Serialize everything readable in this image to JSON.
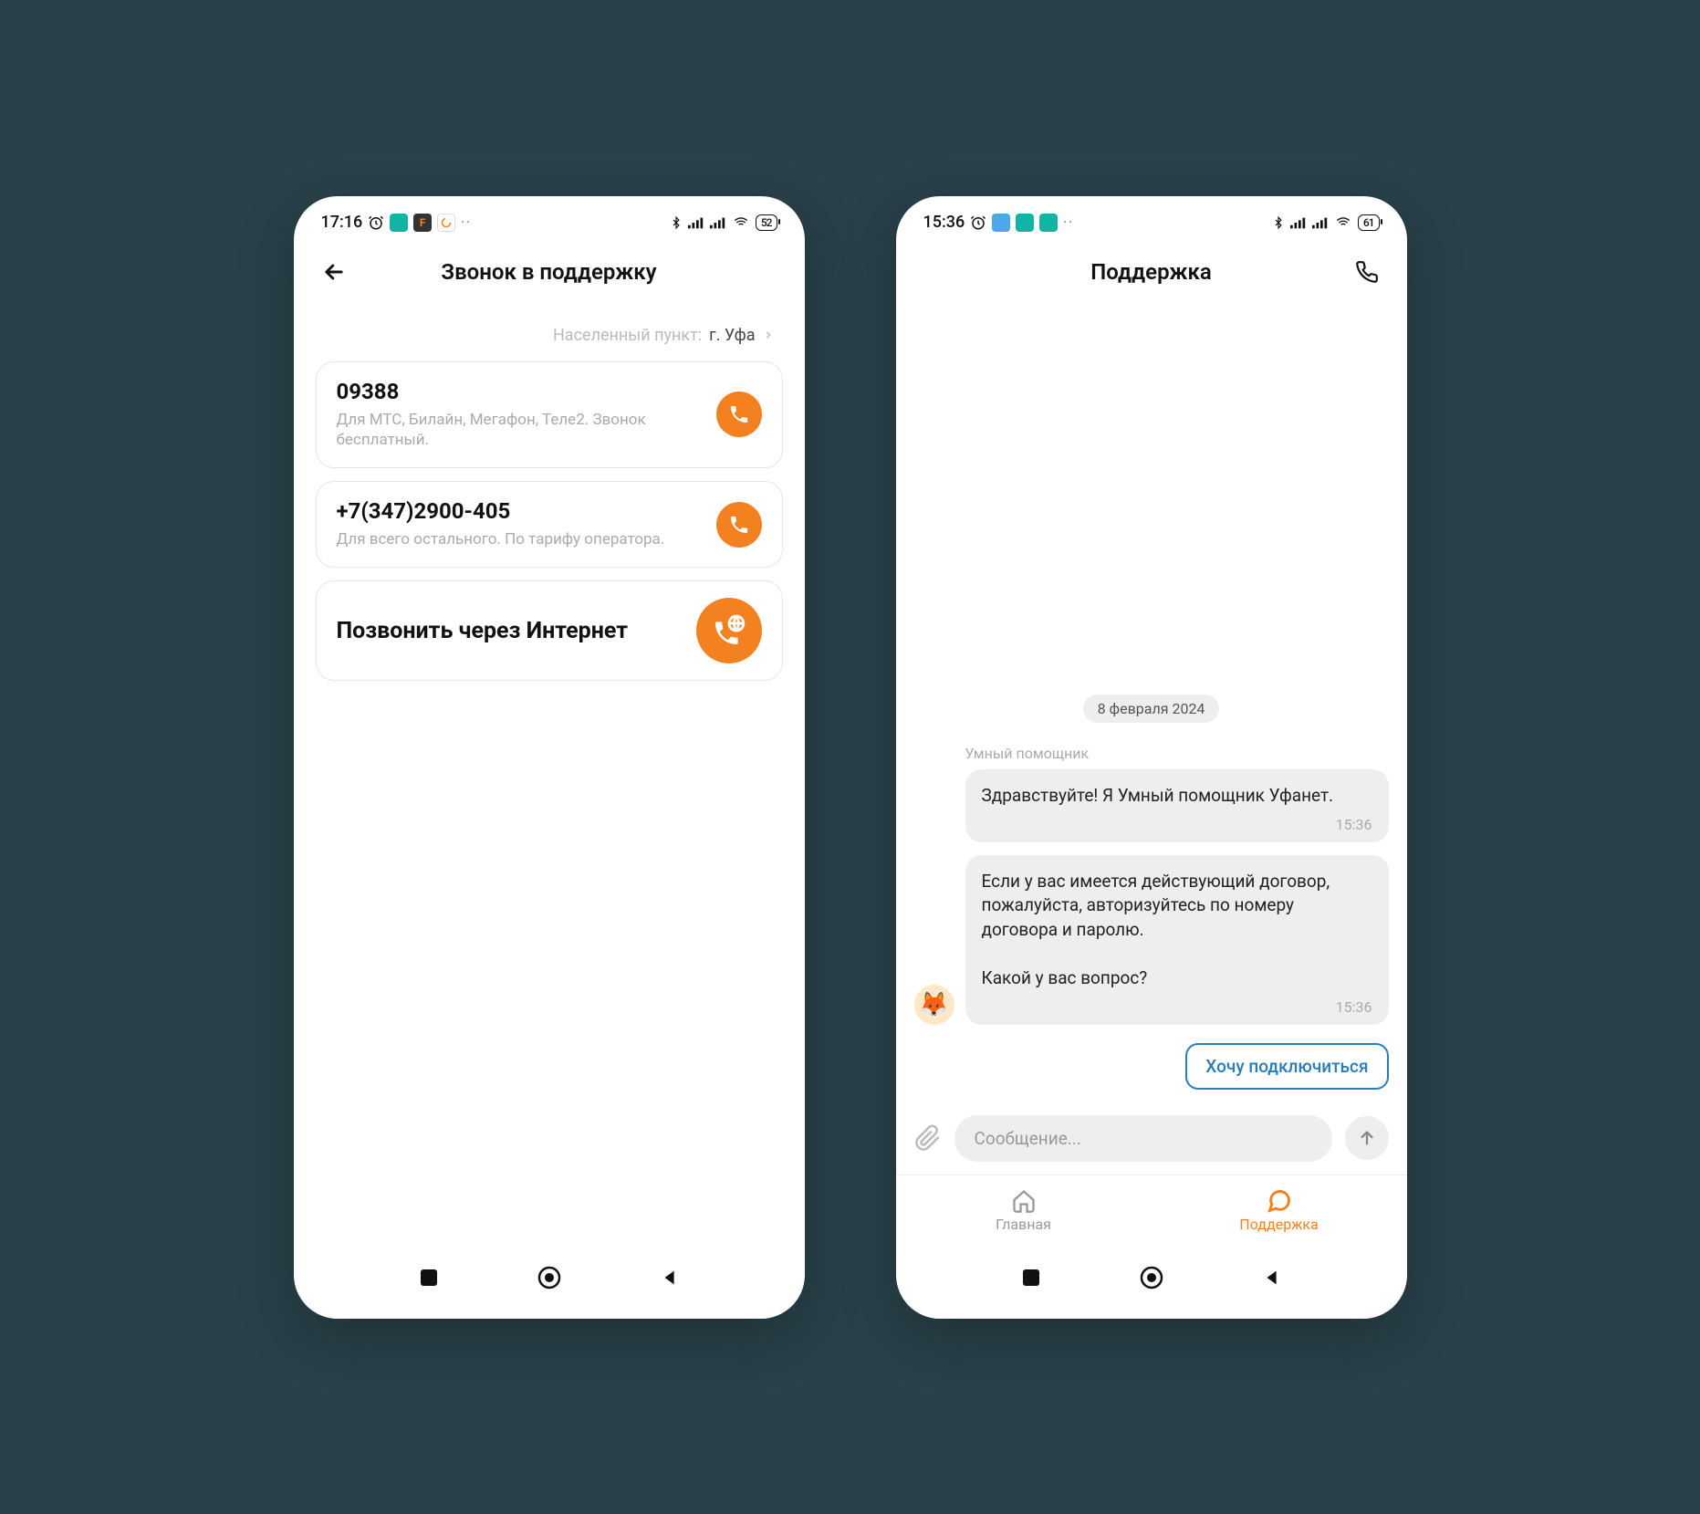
{
  "left_screen": {
    "status": {
      "time": "17:16",
      "battery": "52"
    },
    "header": {
      "title": "Звонок в поддержку"
    },
    "location": {
      "label": "Населенный пункт:",
      "value": "г. Уфа"
    },
    "cards": [
      {
        "title": "09388",
        "subtitle": "Для МТС, Билайн, Мегафон, Теле2. Звонок бесплатный."
      },
      {
        "title": "+7(347)2900-405",
        "subtitle": "Для всего остального. По тарифу оператора."
      },
      {
        "title": "Позвонить через Интернет"
      }
    ]
  },
  "right_screen": {
    "status": {
      "time": "15:36",
      "battery": "61"
    },
    "header": {
      "title": "Поддержка"
    },
    "chat": {
      "date": "8 февраля 2024",
      "sender": "Умный помощник",
      "messages": [
        {
          "text": "Здравствуйте! Я Умный помощник Уфанет.",
          "time": "15:36"
        },
        {
          "text": "Если у вас имеется действующий договор, пожалуйста, авторизуйтесь по номеру договора и паролю.\n\nКакой у вас вопрос?",
          "time": "15:36"
        }
      ],
      "quick_reply": "Хочу подключиться"
    },
    "input": {
      "placeholder": "Сообщение..."
    },
    "nav": {
      "home": "Главная",
      "support": "Поддержка"
    }
  },
  "colors": {
    "accent": "#f48120",
    "link": "#2a7db8"
  }
}
